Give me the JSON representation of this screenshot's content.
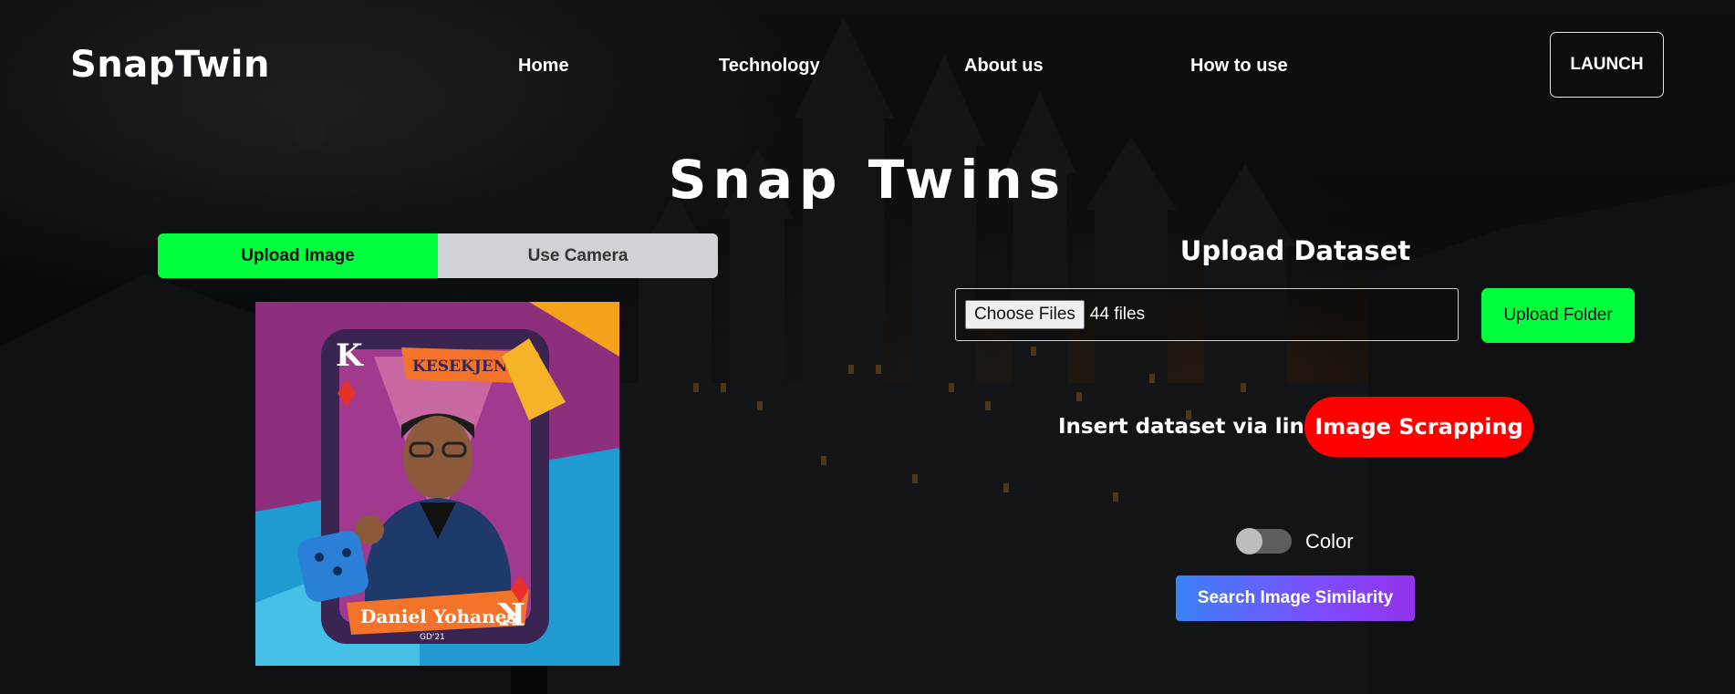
{
  "nav": {
    "brand": "SnapTwin",
    "links": [
      "Home",
      "Technology",
      "About us",
      "How to use"
    ],
    "launch_label": "LAUNCH"
  },
  "hero": {
    "title": "Snap Twins"
  },
  "tabs": [
    {
      "label": "Upload Image",
      "active": true
    },
    {
      "label": "Use Camera",
      "active": false
    }
  ],
  "card": {
    "rank": "K",
    "banner": "KESEKJENAN",
    "name": "Daniel Yohanes",
    "sub": "GD'21"
  },
  "dataset": {
    "title": "Upload Dataset",
    "choose_label": "Choose Files",
    "file_count": "44 files",
    "upload_folder_label": "Upload Folder",
    "link_label": "Insert dataset via link:",
    "scrap_label": "Image Scrapping"
  },
  "options": {
    "color_label": "Color",
    "color_enabled": false
  },
  "search_label": "Search Image Similarity",
  "colors": {
    "accent_green": "#00ff3c",
    "scrap_red": "#ff0000",
    "search_gradient_start": "#3b82f6",
    "search_gradient_end": "#9333ea"
  }
}
